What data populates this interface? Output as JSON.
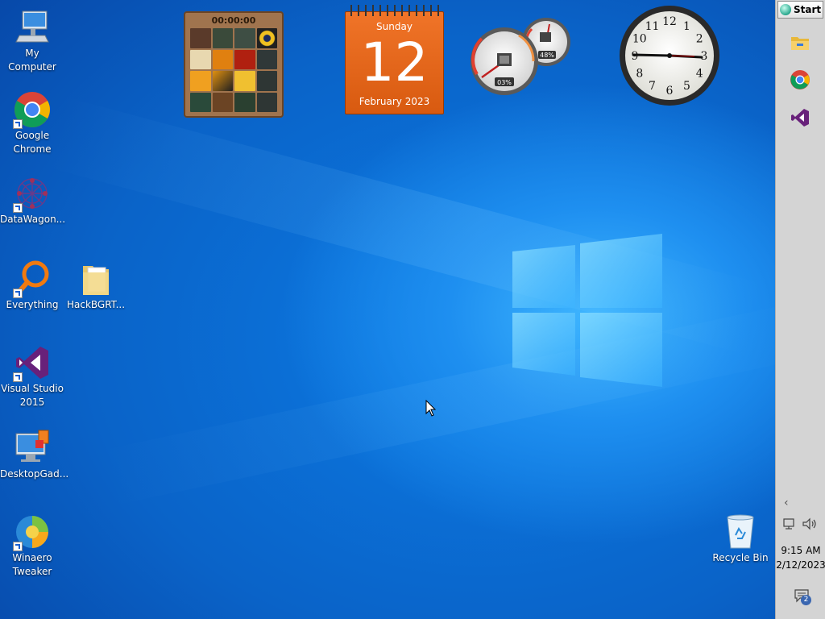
{
  "desktop": {
    "icons": [
      {
        "label": "My Computer"
      },
      {
        "label": "Google\nChrome"
      },
      {
        "label": "DataWagon..."
      },
      {
        "label": "Everything"
      },
      {
        "label": "HackBGRT..."
      },
      {
        "label": "Visual Studio\n2015"
      },
      {
        "label": "DesktopGad..."
      },
      {
        "label": "Winaero\nTweaker"
      },
      {
        "label": "Recycle Bin"
      }
    ]
  },
  "gadgets": {
    "puzzle": {
      "timer": "00:00:00"
    },
    "calendar": {
      "weekday": "Sunday",
      "day": "12",
      "month_year": "February 2023"
    },
    "meters": {
      "cpu": "03%",
      "memory": "48%"
    },
    "clock": {
      "hour_numbers": [
        "12",
        "1",
        "2",
        "3",
        "4",
        "5",
        "6",
        "7",
        "8",
        "9",
        "10",
        "11"
      ]
    }
  },
  "taskbar": {
    "start_label": "Start",
    "apps": [
      {
        "icon": "file-explorer-icon"
      },
      {
        "icon": "chrome-icon"
      },
      {
        "icon": "visual-studio-icon"
      }
    ],
    "time": "9:15 AM",
    "date": "2/12/2023",
    "notification_count": "2"
  },
  "colors": {
    "desktop_blue": "#0a63c8",
    "calendar_orange": "#e8661c",
    "taskbar_gray": "#d4d4d4"
  }
}
